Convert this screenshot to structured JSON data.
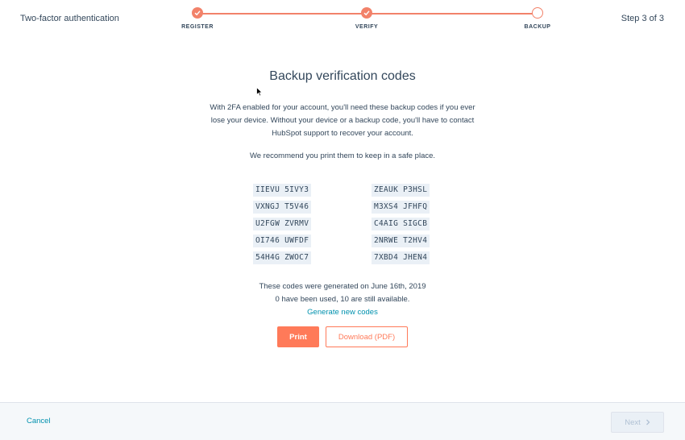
{
  "header": {
    "title": "Two-factor authentication",
    "step_count": "Step 3 of 3",
    "steps": [
      {
        "label": "REGISTER",
        "state": "done"
      },
      {
        "label": "VERIFY",
        "state": "done"
      },
      {
        "label": "BACKUP",
        "state": "current"
      }
    ]
  },
  "main": {
    "title": "Backup verification codes",
    "description": "With 2FA enabled for your account, you'll need these backup codes if you ever lose your device. Without your device or a backup code, you'll have to contact HubSpot support to recover your account.",
    "recommend": "We recommend you print them to keep in a safe place.",
    "codes_left": [
      "IIEVU 5IVY3",
      "VXNGJ T5V46",
      "U2FGW ZVRMV",
      "OI746 UWFDF",
      "54H4G ZWOC7"
    ],
    "codes_right": [
      "ZEAUK P3HSL",
      "M3XS4 JFHFQ",
      "C4AIG SIGCB",
      "2NRWE T2HV4",
      "7XBD4 JHEN4"
    ],
    "generated_text": "These codes were generated on June 16th, 2019",
    "usage_text": "0 have been used, 10 are still available.",
    "generate_link": "Generate new codes",
    "print_label": "Print",
    "download_label": "Download (PDF)"
  },
  "footer": {
    "cancel_label": "Cancel",
    "next_label": "Next"
  },
  "colors": {
    "accent": "#ff7a59",
    "link": "#0091ae",
    "text": "#33475b",
    "code_bg": "#eaf0f6"
  }
}
